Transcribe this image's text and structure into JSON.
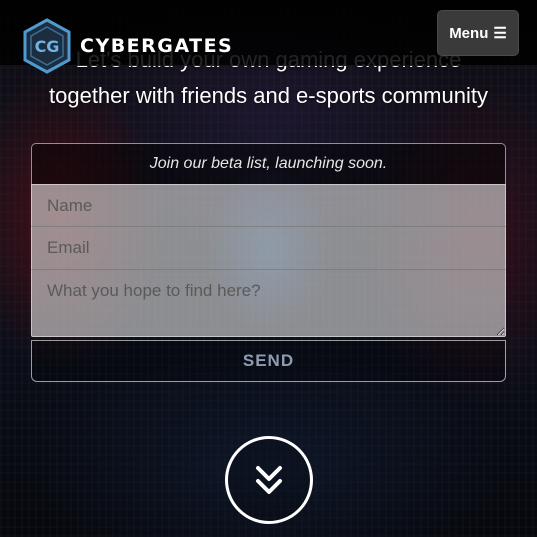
{
  "navbar": {
    "brand_name": "CYBERGATES",
    "logo_letters": "CG",
    "menu_label": "Menu",
    "menu_icon": "hamburger-icon"
  },
  "hero": {
    "tagline_line1": "Let's build your own gaming experience",
    "tagline_line2": "together with friends and e-sports community"
  },
  "form": {
    "heading": "Join our beta list, launching soon.",
    "name_placeholder": "Name",
    "email_placeholder": "Email",
    "message_placeholder": "What you hope to find here?",
    "send_label": "SEND"
  },
  "scroll": {
    "icon": "double-chevron-down-icon"
  },
  "colors": {
    "logo_blue": "#4f9bd0",
    "menu_bg": "#3a3a3a",
    "field_bg": "#dcdcdc",
    "send_text": "#b9cde6"
  }
}
